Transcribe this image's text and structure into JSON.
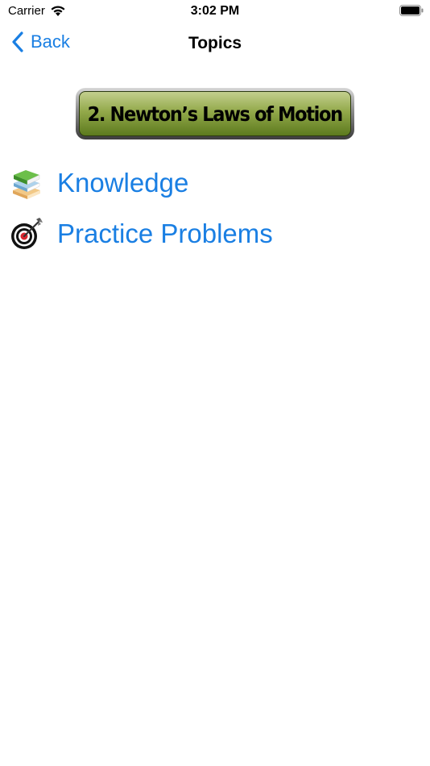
{
  "status_bar": {
    "carrier": "Carrier",
    "time": "3:02 PM"
  },
  "nav": {
    "back_label": "Back",
    "title": "Topics"
  },
  "chapter": {
    "title": "2. Newton’s Laws of Motion"
  },
  "topics": [
    {
      "label": "Knowledge",
      "icon": "books-icon"
    },
    {
      "label": "Practice Problems",
      "icon": "target-dart-icon"
    }
  ],
  "colors": {
    "link_blue": "#1a7fe3",
    "banner_green": "#93a94a"
  }
}
